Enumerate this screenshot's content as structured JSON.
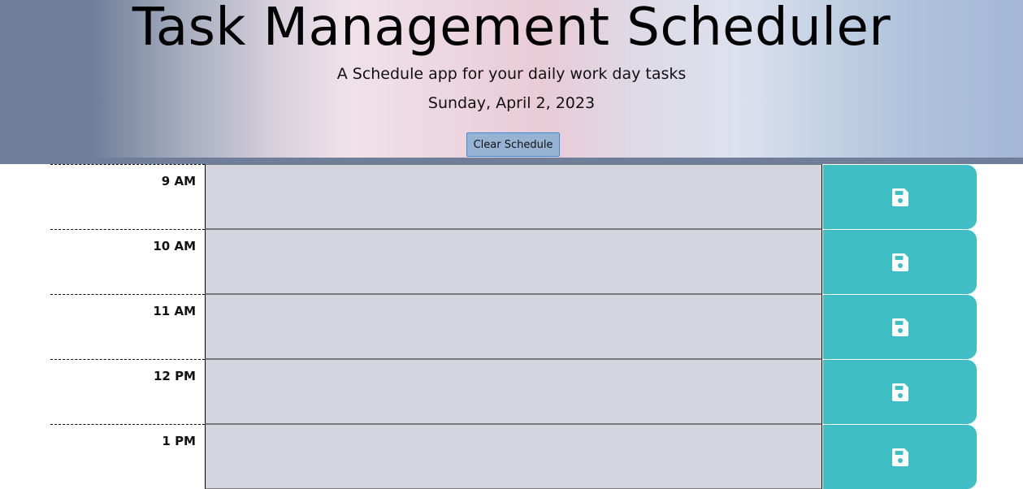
{
  "header": {
    "title": "Task Management Scheduler",
    "subtitle": "A Schedule app for your daily work day tasks",
    "date": "Sunday, April 2, 2023",
    "clear_button_label": "Clear Schedule"
  },
  "schedule": {
    "rows": [
      {
        "hour": "9 AM",
        "task": "",
        "save_icon": "floppy-disk-icon"
      },
      {
        "hour": "10 AM",
        "task": "",
        "save_icon": "floppy-disk-icon"
      },
      {
        "hour": "11 AM",
        "task": "",
        "save_icon": "floppy-disk-icon"
      },
      {
        "hour": "12 PM",
        "task": "",
        "save_icon": "floppy-disk-icon"
      },
      {
        "hour": "1 PM",
        "task": "",
        "save_icon": "floppy-disk-icon"
      }
    ]
  },
  "colors": {
    "save_button": "#40bec5",
    "task_area_past": "#d4d4df",
    "header_bar": "#707e99"
  }
}
